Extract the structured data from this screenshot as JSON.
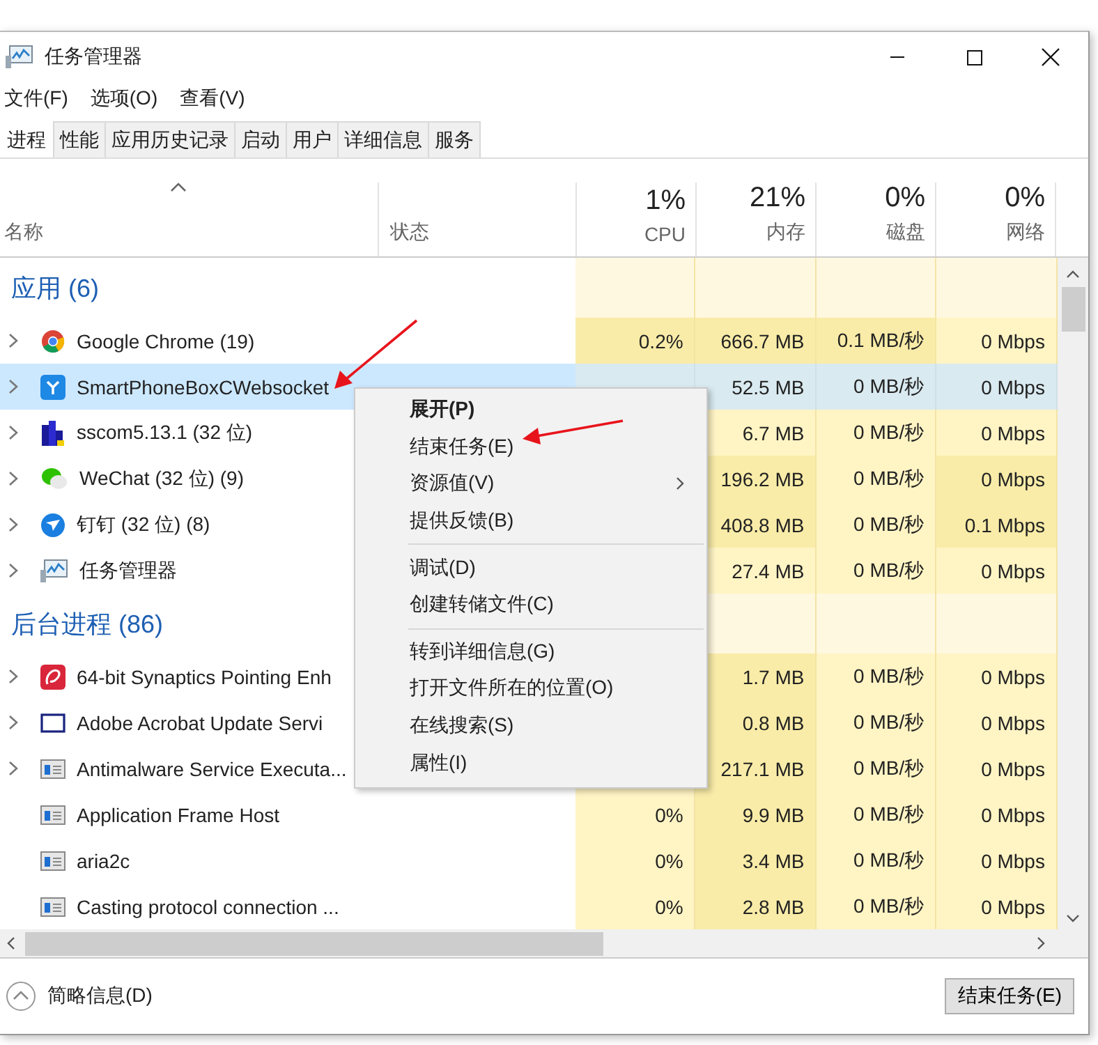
{
  "window": {
    "title": "任务管理器"
  },
  "menu_bar": [
    "文件(F)",
    "选项(O)",
    "查看(V)"
  ],
  "tabs": [
    {
      "label": "进程",
      "selected": true
    },
    {
      "label": "性能",
      "selected": false
    },
    {
      "label": "应用历史记录",
      "selected": false
    },
    {
      "label": "启动",
      "selected": false
    },
    {
      "label": "用户",
      "selected": false
    },
    {
      "label": "详细信息",
      "selected": false
    },
    {
      "label": "服务",
      "selected": false
    }
  ],
  "columns": {
    "name": "名称",
    "status": "状态",
    "cpu": {
      "percent": "1%",
      "label": "CPU"
    },
    "memory": {
      "percent": "21%",
      "label": "内存"
    },
    "disk": {
      "percent": "0%",
      "label": "磁盘"
    },
    "network": {
      "percent": "0%",
      "label": "网络"
    }
  },
  "groups": [
    {
      "title": "应用 (6)",
      "rows": [
        {
          "name": "Google Chrome (19)",
          "expandable": true,
          "selected": false,
          "cpu": {
            "text": "0.2%",
            "heavy": true
          },
          "memory": {
            "text": "666.7 MB",
            "heavy": true
          },
          "disk": {
            "text": "0.1 MB/秒",
            "heavy": true
          },
          "network": {
            "text": "0 Mbps",
            "heavy": false
          }
        },
        {
          "name": "SmartPhoneBoxCWebsocket",
          "expandable": true,
          "selected": true,
          "memory": {
            "text": "52.5 MB"
          },
          "disk": {
            "text": "0 MB/秒"
          },
          "network": {
            "text": "0 Mbps"
          }
        },
        {
          "name": "sscom5.13.1 (32 位)",
          "expandable": true,
          "selected": false,
          "memory": {
            "text": "6.7 MB",
            "heavy": false
          },
          "disk": {
            "text": "0 MB/秒",
            "heavy": false
          },
          "network": {
            "text": "0 Mbps",
            "heavy": false
          }
        },
        {
          "name": "WeChat (32 位) (9)",
          "expandable": true,
          "selected": false,
          "memory": {
            "text": "196.2 MB",
            "heavy": true
          },
          "disk": {
            "text": "0 MB/秒",
            "heavy": false
          },
          "network": {
            "text": "0 Mbps",
            "heavy": true
          }
        },
        {
          "name": "钉钉 (32 位) (8)",
          "expandable": true,
          "selected": false,
          "memory": {
            "text": "408.8 MB",
            "heavy": true
          },
          "disk": {
            "text": "0 MB/秒",
            "heavy": false
          },
          "network": {
            "text": "0.1 Mbps",
            "heavy": true
          }
        },
        {
          "name": "任务管理器",
          "expandable": true,
          "selected": false,
          "memory": {
            "text": "27.4 MB",
            "heavy": false
          },
          "disk": {
            "text": "0 MB/秒",
            "heavy": false
          },
          "network": {
            "text": "0 Mbps",
            "heavy": false
          }
        }
      ]
    },
    {
      "title": "后台进程 (86)",
      "rows": [
        {
          "name": "64-bit Synaptics Pointing Enh",
          "expandable": true,
          "selected": false,
          "memory": {
            "text": "1.7 MB",
            "heavy": true
          },
          "disk": {
            "text": "0 MB/秒",
            "heavy": false
          },
          "network": {
            "text": "0 Mbps",
            "heavy": false
          }
        },
        {
          "name": "Adobe Acrobat Update Servi",
          "expandable": true,
          "selected": false,
          "memory": {
            "text": "0.8 MB",
            "heavy": true
          },
          "disk": {
            "text": "0 MB/秒",
            "heavy": false
          },
          "network": {
            "text": "0 Mbps",
            "heavy": false
          }
        },
        {
          "name": "Antimalware Service Executa...",
          "expandable": true,
          "selected": false,
          "memory": {
            "text": "217.1 MB",
            "heavy": true
          },
          "disk": {
            "text": "0 MB/秒",
            "heavy": false
          },
          "network": {
            "text": "0 Mbps",
            "heavy": false
          }
        },
        {
          "name": "Application Frame Host",
          "expandable": false,
          "selected": false,
          "cpu": {
            "text": "0%",
            "heavy": false
          },
          "memory": {
            "text": "9.9 MB",
            "heavy": true
          },
          "disk": {
            "text": "0 MB/秒",
            "heavy": false
          },
          "network": {
            "text": "0 Mbps",
            "heavy": false
          }
        },
        {
          "name": "aria2c",
          "expandable": false,
          "selected": false,
          "cpu": {
            "text": "0%",
            "heavy": false
          },
          "memory": {
            "text": "3.4 MB",
            "heavy": true
          },
          "disk": {
            "text": "0 MB/秒",
            "heavy": false
          },
          "network": {
            "text": "0 Mbps",
            "heavy": false
          }
        },
        {
          "name": "Casting protocol connection ...",
          "expandable": false,
          "selected": false,
          "cpu": {
            "text": "0%",
            "heavy": false
          },
          "memory": {
            "text": "2.8 MB",
            "heavy": true
          },
          "disk": {
            "text": "0 MB/秒",
            "heavy": false
          },
          "network": {
            "text": "0 Mbps",
            "heavy": false
          }
        }
      ]
    }
  ],
  "context_menu": [
    {
      "kind": "item",
      "label": "展开(P)",
      "default": true,
      "submenu": false
    },
    {
      "kind": "item",
      "label": "结束任务(E)",
      "default": false,
      "submenu": false
    },
    {
      "kind": "item",
      "label": "资源值(V)",
      "default": false,
      "submenu": true
    },
    {
      "kind": "item",
      "label": "提供反馈(B)",
      "default": false,
      "submenu": false
    },
    {
      "kind": "separator"
    },
    {
      "kind": "item",
      "label": "调试(D)",
      "default": false,
      "submenu": false
    },
    {
      "kind": "item",
      "label": "创建转储文件(C)",
      "default": false,
      "submenu": false
    },
    {
      "kind": "separator"
    },
    {
      "kind": "item",
      "label": "转到详细信息(G)",
      "default": false,
      "submenu": false
    },
    {
      "kind": "item",
      "label": "打开文件所在的位置(O)",
      "default": false,
      "submenu": false
    },
    {
      "kind": "item",
      "label": "在线搜索(S)",
      "default": false,
      "submenu": false
    },
    {
      "kind": "item",
      "label": "属性(I)",
      "default": false,
      "submenu": false
    }
  ],
  "footer": {
    "details_toggle": "简略信息(D)",
    "end_task_button": "结束任务(E)"
  }
}
